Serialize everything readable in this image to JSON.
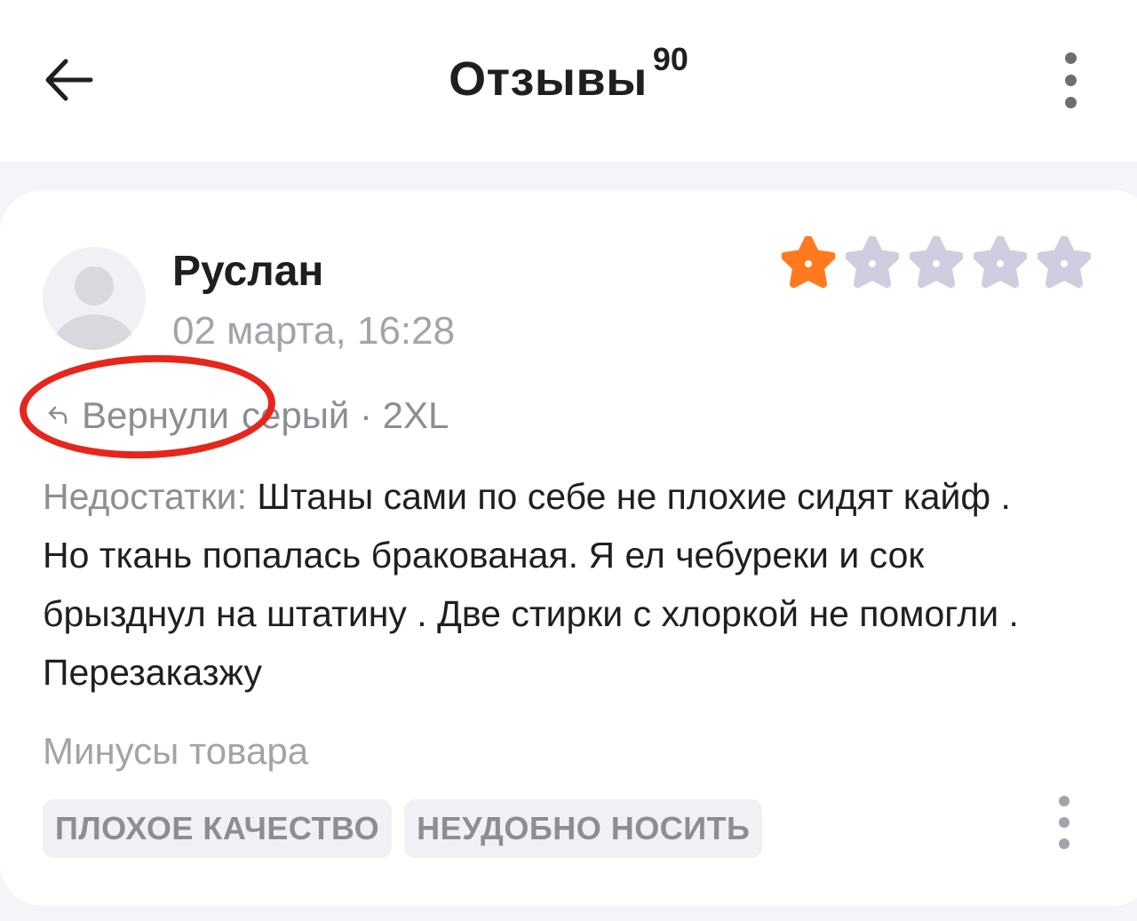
{
  "header": {
    "title": "Отзывы",
    "count": "90",
    "back_icon": "arrow-left-icon",
    "menu_icon": "more-vertical-icon"
  },
  "review": {
    "author": "Руслан",
    "date": "02 марта, 16:28",
    "rating": 1,
    "rating_max": 5,
    "return_label": "Вернули",
    "variant": "серый · 2XL",
    "cons_label": "Недостатки:",
    "cons_text": "Штаны сами по себе не плохие сидят кайф . Но ткань попалась бракованая. Я ел чебуреки и сок брызднул на штатину . Две стирки с хлоркой не помогли . Перезаказжу",
    "minus_section_label": "Минусы товара",
    "tags": [
      "ПЛОХОЕ КАЧЕСТВО",
      "НЕУДОБНО НОСИТЬ"
    ]
  },
  "colors": {
    "star_active": "#ff7a1f",
    "star_inactive": "#cfcde0",
    "highlight_ring": "#e5261c",
    "text_primary": "#1f1f1f",
    "text_secondary": "#8d8d95"
  }
}
